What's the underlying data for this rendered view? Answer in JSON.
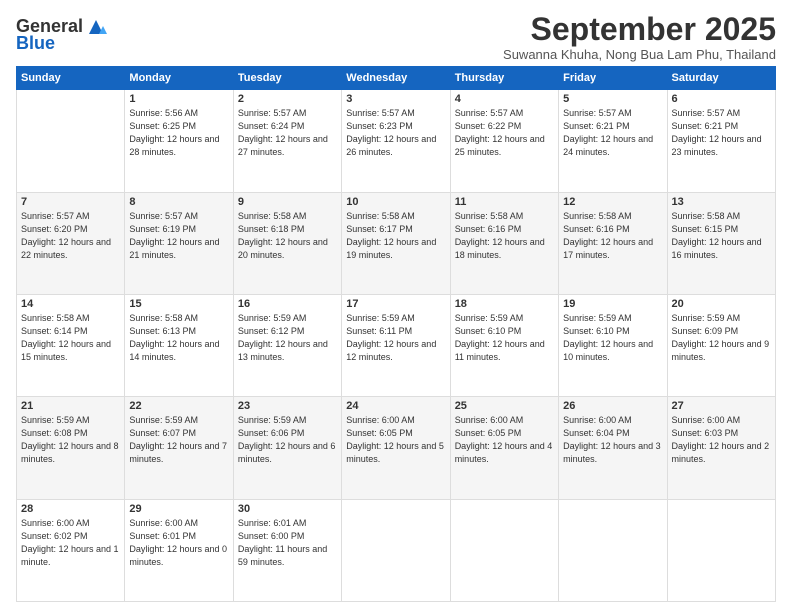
{
  "logo": {
    "general": "General",
    "blue": "Blue"
  },
  "header": {
    "title": "September 2025",
    "subtitle": "Suwanna Khuha, Nong Bua Lam Phu, Thailand"
  },
  "weekdays": [
    "Sunday",
    "Monday",
    "Tuesday",
    "Wednesday",
    "Thursday",
    "Friday",
    "Saturday"
  ],
  "weeks": [
    [
      {
        "day": "",
        "sunrise": "",
        "sunset": "",
        "daylight": "",
        "empty": true
      },
      {
        "day": "1",
        "sunrise": "Sunrise: 5:56 AM",
        "sunset": "Sunset: 6:25 PM",
        "daylight": "Daylight: 12 hours and 28 minutes."
      },
      {
        "day": "2",
        "sunrise": "Sunrise: 5:57 AM",
        "sunset": "Sunset: 6:24 PM",
        "daylight": "Daylight: 12 hours and 27 minutes."
      },
      {
        "day": "3",
        "sunrise": "Sunrise: 5:57 AM",
        "sunset": "Sunset: 6:23 PM",
        "daylight": "Daylight: 12 hours and 26 minutes."
      },
      {
        "day": "4",
        "sunrise": "Sunrise: 5:57 AM",
        "sunset": "Sunset: 6:22 PM",
        "daylight": "Daylight: 12 hours and 25 minutes."
      },
      {
        "day": "5",
        "sunrise": "Sunrise: 5:57 AM",
        "sunset": "Sunset: 6:21 PM",
        "daylight": "Daylight: 12 hours and 24 minutes."
      },
      {
        "day": "6",
        "sunrise": "Sunrise: 5:57 AM",
        "sunset": "Sunset: 6:21 PM",
        "daylight": "Daylight: 12 hours and 23 minutes."
      }
    ],
    [
      {
        "day": "7",
        "sunrise": "Sunrise: 5:57 AM",
        "sunset": "Sunset: 6:20 PM",
        "daylight": "Daylight: 12 hours and 22 minutes."
      },
      {
        "day": "8",
        "sunrise": "Sunrise: 5:57 AM",
        "sunset": "Sunset: 6:19 PM",
        "daylight": "Daylight: 12 hours and 21 minutes."
      },
      {
        "day": "9",
        "sunrise": "Sunrise: 5:58 AM",
        "sunset": "Sunset: 6:18 PM",
        "daylight": "Daylight: 12 hours and 20 minutes."
      },
      {
        "day": "10",
        "sunrise": "Sunrise: 5:58 AM",
        "sunset": "Sunset: 6:17 PM",
        "daylight": "Daylight: 12 hours and 19 minutes."
      },
      {
        "day": "11",
        "sunrise": "Sunrise: 5:58 AM",
        "sunset": "Sunset: 6:16 PM",
        "daylight": "Daylight: 12 hours and 18 minutes."
      },
      {
        "day": "12",
        "sunrise": "Sunrise: 5:58 AM",
        "sunset": "Sunset: 6:16 PM",
        "daylight": "Daylight: 12 hours and 17 minutes."
      },
      {
        "day": "13",
        "sunrise": "Sunrise: 5:58 AM",
        "sunset": "Sunset: 6:15 PM",
        "daylight": "Daylight: 12 hours and 16 minutes."
      }
    ],
    [
      {
        "day": "14",
        "sunrise": "Sunrise: 5:58 AM",
        "sunset": "Sunset: 6:14 PM",
        "daylight": "Daylight: 12 hours and 15 minutes."
      },
      {
        "day": "15",
        "sunrise": "Sunrise: 5:58 AM",
        "sunset": "Sunset: 6:13 PM",
        "daylight": "Daylight: 12 hours and 14 minutes."
      },
      {
        "day": "16",
        "sunrise": "Sunrise: 5:59 AM",
        "sunset": "Sunset: 6:12 PM",
        "daylight": "Daylight: 12 hours and 13 minutes."
      },
      {
        "day": "17",
        "sunrise": "Sunrise: 5:59 AM",
        "sunset": "Sunset: 6:11 PM",
        "daylight": "Daylight: 12 hours and 12 minutes."
      },
      {
        "day": "18",
        "sunrise": "Sunrise: 5:59 AM",
        "sunset": "Sunset: 6:10 PM",
        "daylight": "Daylight: 12 hours and 11 minutes."
      },
      {
        "day": "19",
        "sunrise": "Sunrise: 5:59 AM",
        "sunset": "Sunset: 6:10 PM",
        "daylight": "Daylight: 12 hours and 10 minutes."
      },
      {
        "day": "20",
        "sunrise": "Sunrise: 5:59 AM",
        "sunset": "Sunset: 6:09 PM",
        "daylight": "Daylight: 12 hours and 9 minutes."
      }
    ],
    [
      {
        "day": "21",
        "sunrise": "Sunrise: 5:59 AM",
        "sunset": "Sunset: 6:08 PM",
        "daylight": "Daylight: 12 hours and 8 minutes."
      },
      {
        "day": "22",
        "sunrise": "Sunrise: 5:59 AM",
        "sunset": "Sunset: 6:07 PM",
        "daylight": "Daylight: 12 hours and 7 minutes."
      },
      {
        "day": "23",
        "sunrise": "Sunrise: 5:59 AM",
        "sunset": "Sunset: 6:06 PM",
        "daylight": "Daylight: 12 hours and 6 minutes."
      },
      {
        "day": "24",
        "sunrise": "Sunrise: 6:00 AM",
        "sunset": "Sunset: 6:05 PM",
        "daylight": "Daylight: 12 hours and 5 minutes."
      },
      {
        "day": "25",
        "sunrise": "Sunrise: 6:00 AM",
        "sunset": "Sunset: 6:05 PM",
        "daylight": "Daylight: 12 hours and 4 minutes."
      },
      {
        "day": "26",
        "sunrise": "Sunrise: 6:00 AM",
        "sunset": "Sunset: 6:04 PM",
        "daylight": "Daylight: 12 hours and 3 minutes."
      },
      {
        "day": "27",
        "sunrise": "Sunrise: 6:00 AM",
        "sunset": "Sunset: 6:03 PM",
        "daylight": "Daylight: 12 hours and 2 minutes."
      }
    ],
    [
      {
        "day": "28",
        "sunrise": "Sunrise: 6:00 AM",
        "sunset": "Sunset: 6:02 PM",
        "daylight": "Daylight: 12 hours and 1 minute."
      },
      {
        "day": "29",
        "sunrise": "Sunrise: 6:00 AM",
        "sunset": "Sunset: 6:01 PM",
        "daylight": "Daylight: 12 hours and 0 minutes."
      },
      {
        "day": "30",
        "sunrise": "Sunrise: 6:01 AM",
        "sunset": "Sunset: 6:00 PM",
        "daylight": "Daylight: 11 hours and 59 minutes."
      },
      {
        "day": "",
        "sunrise": "",
        "sunset": "",
        "daylight": "",
        "empty": true
      },
      {
        "day": "",
        "sunrise": "",
        "sunset": "",
        "daylight": "",
        "empty": true
      },
      {
        "day": "",
        "sunrise": "",
        "sunset": "",
        "daylight": "",
        "empty": true
      },
      {
        "day": "",
        "sunrise": "",
        "sunset": "",
        "daylight": "",
        "empty": true
      }
    ]
  ]
}
